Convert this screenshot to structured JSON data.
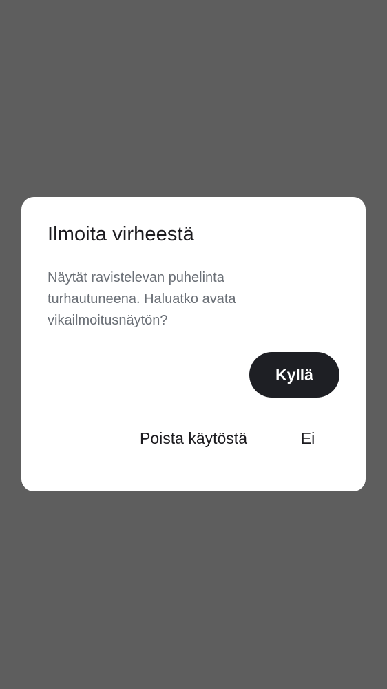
{
  "dialog": {
    "title": "Ilmoita virheestä",
    "message": "Näytät ravistelevan puhelinta turhautuneena. Haluatko avata vikailmoitusnäytön?",
    "buttons": {
      "yes_label": "Kyllä",
      "disable_label": "Poista käytöstä",
      "no_label": "Ei"
    }
  },
  "colors": {
    "scrim": "#5e5e5e",
    "surface": "#ffffff",
    "primary_button": "#1e1f24",
    "title_text": "#1c1b1f",
    "body_text": "#6a6f76"
  }
}
